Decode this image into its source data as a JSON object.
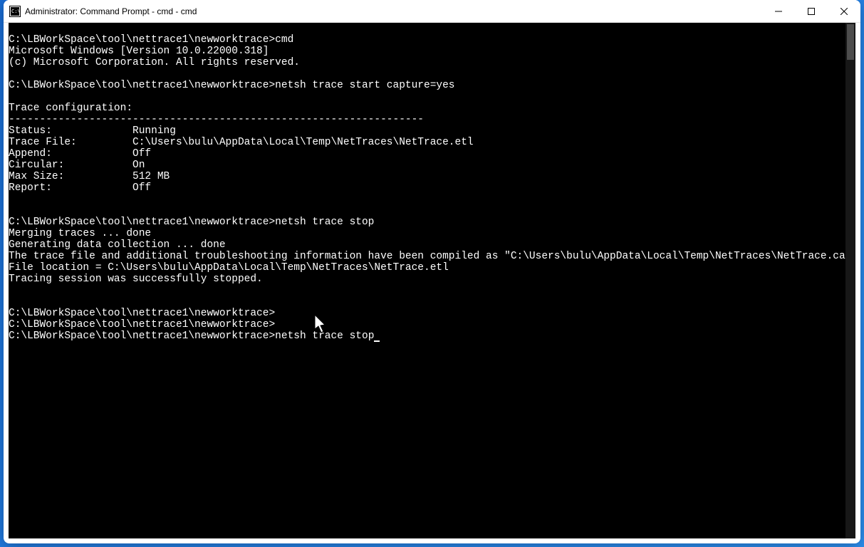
{
  "window": {
    "title": "Administrator: Command Prompt - cmd - cmd"
  },
  "console": {
    "lines": [
      "",
      "C:\\LBWorkSpace\\tool\\nettrace1\\newworktrace>cmd",
      "Microsoft Windows [Version 10.0.22000.318]",
      "(c) Microsoft Corporation. All rights reserved.",
      "",
      "C:\\LBWorkSpace\\tool\\nettrace1\\newworktrace>netsh trace start capture=yes",
      "",
      "Trace configuration:",
      "-------------------------------------------------------------------",
      "Status:             Running",
      "Trace File:         C:\\Users\\bulu\\AppData\\Local\\Temp\\NetTraces\\NetTrace.etl",
      "Append:             Off",
      "Circular:           On",
      "Max Size:           512 MB",
      "Report:             Off",
      "",
      "",
      "C:\\LBWorkSpace\\tool\\nettrace1\\newworktrace>netsh trace stop",
      "Merging traces ... done",
      "Generating data collection ... done",
      "The trace file and additional troubleshooting information have been compiled as \"C:\\Users\\bulu\\AppData\\Local\\Temp\\NetTraces\\NetTrace.cab\".",
      "File location = C:\\Users\\bulu\\AppData\\Local\\Temp\\NetTraces\\NetTrace.etl",
      "Tracing session was successfully stopped.",
      "",
      "",
      "C:\\LBWorkSpace\\tool\\nettrace1\\newworktrace>",
      "C:\\LBWorkSpace\\tool\\nettrace1\\newworktrace>"
    ],
    "current_prompt": "C:\\LBWorkSpace\\tool\\nettrace1\\newworktrace>",
    "current_input": "netsh trace stop"
  }
}
